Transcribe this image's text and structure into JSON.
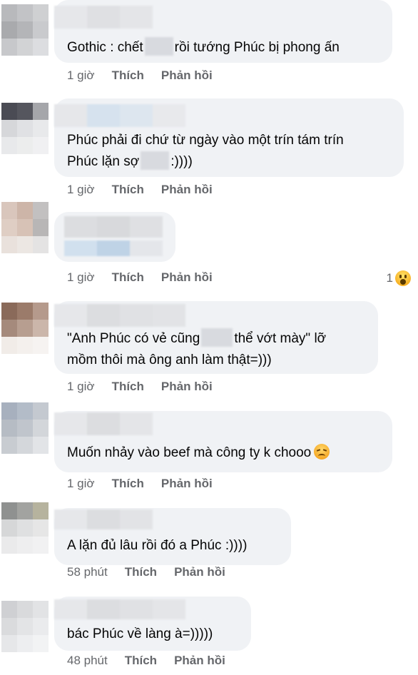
{
  "comments": [
    {
      "lines": [
        "Gothic : chết",
        "rồi tướng Phúc bị phong ấn"
      ],
      "time": "1 giờ",
      "like": "Thích",
      "reply": "Phản hồi"
    },
    {
      "lines": [
        "Phúc phải đi chứ từ ngày vào một trín tám trín",
        "Phúc lặn sợ",
        ":))))"
      ],
      "time": "1 giờ",
      "like": "Thích",
      "reply": "Phản hồi"
    },
    {
      "time": "1 giờ",
      "like": "Thích",
      "reply": "Phản hồi",
      "reaction_count": "1",
      "reaction_icon": "wow-reaction-icon"
    },
    {
      "lines": [
        "\"Anh Phúc có vẻ cũng",
        "thể vớt mày\" lỡ",
        "mồm thôi mà ông anh làm thật=)))"
      ],
      "time": "1 giờ",
      "like": "Thích",
      "reply": "Phản hồi"
    },
    {
      "lines": [
        "Muốn nhảy vào beef mà công ty k chooo"
      ],
      "emoji": "sad-face-emoji",
      "time": "1 giờ",
      "like": "Thích",
      "reply": "Phản hồi"
    },
    {
      "lines": [
        "A lặn đủ lâu rồi đó a Phúc :))))"
      ],
      "time": "58 phút",
      "like": "Thích",
      "reply": "Phản hồi"
    },
    {
      "lines": [
        "bác Phúc về làng à=)))))"
      ],
      "time": "48 phút",
      "like": "Thích",
      "reply": "Phản hồi"
    }
  ],
  "colors": {
    "bubble": "#f0f2f5",
    "meta": "#65676b",
    "text": "#050505"
  }
}
